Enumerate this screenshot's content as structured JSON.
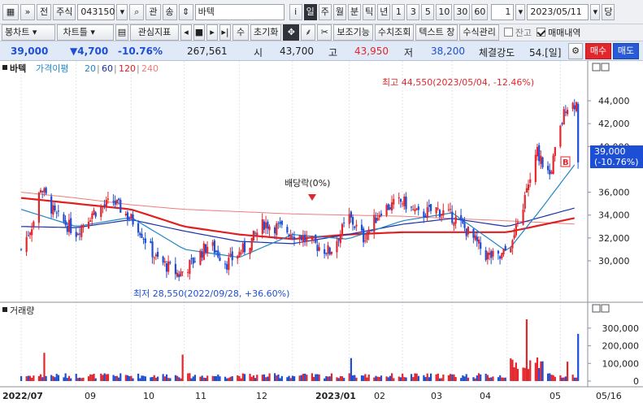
{
  "toolbar1": {
    "menu_icon": "menu-icon",
    "nav_icon": "double-chevron-icon",
    "buttons": [
      "전",
      "주식"
    ],
    "code": "043150",
    "mini_buttons": [
      "관",
      "송"
    ],
    "name": "바텍",
    "period_buttons": [
      "i",
      "일",
      "주",
      "월",
      "분",
      "틱",
      "년",
      "1",
      "3",
      "5",
      "10",
      "30",
      "60"
    ],
    "selected_period": "일",
    "count": "1",
    "date": "2023/05/11",
    "day_button": "당"
  },
  "toolbar2": {
    "buttons": [
      "봉차트",
      "차트틀",
      "관심지표",
      "수",
      "초기화",
      "보조기능",
      "수치조회",
      "텍스트 창",
      "수식관리"
    ],
    "checkboxes": [
      {
        "label": "잔고",
        "checked": false
      },
      {
        "label": "매매내역",
        "checked": true
      }
    ]
  },
  "price_bar": {
    "price": "39,000",
    "change": "▼4,700",
    "change_pct": "-10.76%",
    "volume": "267,561",
    "open_label": "시",
    "open": "43,700",
    "high_label": "고",
    "high": "43,950",
    "low_label": "저",
    "low": "38,200",
    "strength_label": "체결강도",
    "strength": "54.[일]",
    "buy": "매수",
    "sell": "매도"
  },
  "legend": {
    "name": "바텍",
    "ma_label": "가격이평",
    "ma": [
      {
        "period": "20",
        "color": "#1e86c8"
      },
      {
        "period": "60",
        "color": "#1a2fa8"
      },
      {
        "period": "120",
        "color": "#e02020"
      },
      {
        "period": "240",
        "color": "#f07c7c"
      }
    ]
  },
  "colors": {
    "up": "#e3262c",
    "down": "#1d4fd6"
  },
  "chart_data": {
    "type": "candlestick",
    "price_axis": {
      "ticks": [
        "44,000",
        "42,000",
        "40,000",
        "36,000",
        "34,000",
        "32,000",
        "30,000"
      ],
      "ylim": [
        28000,
        46000
      ]
    },
    "current_price_tag": "39,000",
    "current_change_tag": "(-10.76%)",
    "annotations": {
      "high": "최고 44,550(2023/05/04, -12.46%)",
      "low": "최저 28,550(2022/09/28, +36.60%)",
      "dividend": "배당락(0%)",
      "buy_marker": "B"
    },
    "x_labels": [
      "2022/07",
      "09",
      "10",
      "11",
      "12",
      "2023/01",
      "02",
      "03",
      "04",
      "05",
      "05/16"
    ],
    "close_path": [
      [
        "2022-07-01",
        31000
      ],
      [
        "2022-07-08",
        33500
      ],
      [
        "2022-07-12",
        36500
      ],
      [
        "2022-07-20",
        34000
      ],
      [
        "2022-08-01",
        32500
      ],
      [
        "2022-08-10",
        34200
      ],
      [
        "2022-08-22",
        35200
      ],
      [
        "2022-09-05",
        33000
      ],
      [
        "2022-09-15",
        30200
      ],
      [
        "2022-09-28",
        28800
      ],
      [
        "2022-10-05",
        29800
      ],
      [
        "2022-10-15",
        31500
      ],
      [
        "2022-10-25",
        29800
      ],
      [
        "2022-11-05",
        31200
      ],
      [
        "2022-11-15",
        33300
      ],
      [
        "2022-11-25",
        32800
      ],
      [
        "2022-12-05",
        32200
      ],
      [
        "2022-12-15",
        31300
      ],
      [
        "2022-12-22",
        30800
      ],
      [
        "2023-01-02",
        33800
      ],
      [
        "2023-01-10",
        32000
      ],
      [
        "2023-01-20",
        34500
      ],
      [
        "2023-02-01",
        35200
      ],
      [
        "2023-02-10",
        34000
      ],
      [
        "2023-02-20",
        34500
      ],
      [
        "2023-03-02",
        33800
      ],
      [
        "2023-03-10",
        32500
      ],
      [
        "2023-03-20",
        30500
      ],
      [
        "2023-03-28",
        30200
      ],
      [
        "2023-04-05",
        32000
      ],
      [
        "2023-04-12",
        36000
      ],
      [
        "2023-04-18",
        39500
      ],
      [
        "2023-04-25",
        37500
      ],
      [
        "2023-05-04",
        43500
      ],
      [
        "2023-05-10",
        43800
      ],
      [
        "2023-05-11",
        39000
      ]
    ],
    "ma20": [
      [
        "2022-07-01",
        34500
      ],
      [
        "2022-08-01",
        33000
      ],
      [
        "2022-09-01",
        33800
      ],
      [
        "2022-10-01",
        31000
      ],
      [
        "2022-11-01",
        30300
      ],
      [
        "2022-12-01",
        32300
      ],
      [
        "2023-01-01",
        31900
      ],
      [
        "2023-02-01",
        33500
      ],
      [
        "2023-03-01",
        34200
      ],
      [
        "2023-04-01",
        30800
      ],
      [
        "2023-04-20",
        34500
      ],
      [
        "2023-05-11",
        38800
      ]
    ],
    "ma60": [
      [
        "2022-07-01",
        33000
      ],
      [
        "2022-08-01",
        32900
      ],
      [
        "2022-09-01",
        33600
      ],
      [
        "2022-10-01",
        32600
      ],
      [
        "2022-11-01",
        31700
      ],
      [
        "2022-12-01",
        31500
      ],
      [
        "2023-01-01",
        32300
      ],
      [
        "2023-02-01",
        33200
      ],
      [
        "2023-03-01",
        33700
      ],
      [
        "2023-04-01",
        33000
      ],
      [
        "2023-05-11",
        34700
      ]
    ],
    "ma120": [
      [
        "2022-07-01",
        35500
      ],
      [
        "2022-08-01",
        35000
      ],
      [
        "2022-09-01",
        34500
      ],
      [
        "2022-10-01",
        33000
      ],
      [
        "2022-11-01",
        32300
      ],
      [
        "2022-12-01",
        31900
      ],
      [
        "2023-01-01",
        32300
      ],
      [
        "2023-02-01",
        32500
      ],
      [
        "2023-03-01",
        32500
      ],
      [
        "2023-04-01",
        32500
      ],
      [
        "2023-05-11",
        33800
      ]
    ],
    "ma240": [
      [
        "2022-07-01",
        36000
      ],
      [
        "2022-08-01",
        35500
      ],
      [
        "2022-09-01",
        34900
      ],
      [
        "2022-10-01",
        34500
      ],
      [
        "2022-11-01",
        34300
      ],
      [
        "2022-12-01",
        34100
      ],
      [
        "2023-01-01",
        34000
      ],
      [
        "2023-02-01",
        33900
      ],
      [
        "2023-03-01",
        33700
      ],
      [
        "2023-04-01",
        33500
      ],
      [
        "2023-05-11",
        33200
      ]
    ],
    "volume_panel": {
      "title": "거래량",
      "ticks": [
        "300,000",
        "200,000",
        "100,000",
        "0"
      ],
      "ylim": [
        0,
        350000
      ],
      "spikes": [
        [
          "2022-07-14",
          160000
        ],
        [
          "2022-09-30",
          150000
        ],
        [
          "2023-01-03",
          130000
        ],
        [
          "2023-04-12",
          350000
        ],
        [
          "2023-05-05",
          110000
        ],
        [
          "2023-05-11",
          267561
        ]
      ]
    }
  }
}
